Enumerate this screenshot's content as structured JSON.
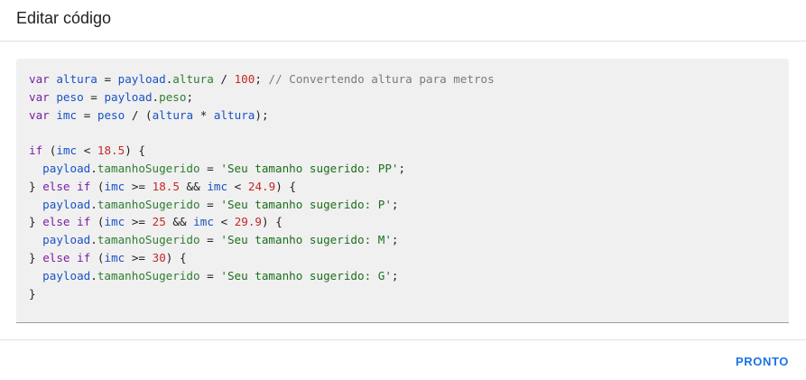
{
  "dialog": {
    "title": "Editar código",
    "done_label": "PRONTO"
  },
  "colors": {
    "keyword": "#7a1fa2",
    "variable": "#1a52c4",
    "property": "#2e7d32",
    "number": "#c62828",
    "string": "#1b6e1b",
    "comment": "#7a7a7a",
    "accent": "#1a73e8",
    "editor_background": "#f0f0f0"
  },
  "code": {
    "language": "javascript",
    "lines": [
      "var altura = payload.altura / 100; // Convertendo altura para metros",
      "var peso = payload.peso;",
      "var imc = peso / (altura * altura);",
      "",
      "if (imc < 18.5) {",
      "  payload.tamanhoSugerido = 'Seu tamanho sugerido: PP';",
      "} else if (imc >= 18.5 && imc < 24.9) {",
      "  payload.tamanhoSugerido = 'Seu tamanho sugerido: P';",
      "} else if (imc >= 25 && imc < 29.9) {",
      "  payload.tamanhoSugerido = 'Seu tamanho sugerido: M';",
      "} else if (imc >= 30) {",
      "  payload.tamanhoSugerido = 'Seu tamanho sugerido: G';",
      "}"
    ]
  }
}
